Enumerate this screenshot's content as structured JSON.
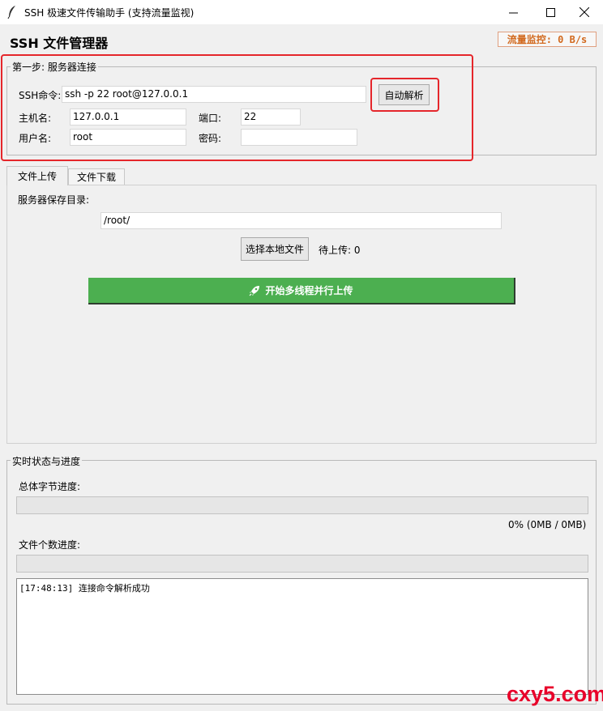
{
  "window": {
    "title": "SSH 极速文件传输助手 (支持流量监视)",
    "icon": "feather-icon",
    "controls": [
      "minimize-icon",
      "maximize-icon",
      "close-icon"
    ]
  },
  "header": {
    "app_title": "SSH 文件管理器",
    "traffic_monitor": "流量监控: 0 B/s",
    "traffic_color": "#d2691e"
  },
  "connection": {
    "group_label": "第一步: 服务器连接",
    "ssh_cmd_label": "SSH命令:",
    "ssh_cmd_value": "ssh -p 22 root@127.0.0.1",
    "parse_button": "自动解析",
    "host_label": "主机名:",
    "host_value": "127.0.0.1",
    "port_label": "端口:",
    "port_value": "22",
    "user_label": "用户名:",
    "user_value": "root",
    "password_label": "密码:",
    "password_value": "",
    "highlight_color": "#e5262b"
  },
  "tabs": [
    {
      "label": "文件上传",
      "active": true
    },
    {
      "label": "文件下载",
      "active": false
    }
  ],
  "upload": {
    "save_dir_label": "服务器保存目录:",
    "save_dir_value": "/root/",
    "select_button": "选择本地文件",
    "pending_text": "待上传: 0",
    "start_button": "开始多线程并行上传",
    "start_icon": "rocket-icon",
    "start_color": "#4caf50"
  },
  "status": {
    "group_label": "实时状态与进度",
    "bytes_label": "总体字节进度:",
    "bytes_progress": 0,
    "bytes_text": "0% (0MB / 0MB)",
    "files_label": "文件个数进度:",
    "files_progress": 0,
    "log_lines": [
      "[17:48:13] 连接命令解析成功"
    ]
  },
  "watermark": "cxy5.com"
}
